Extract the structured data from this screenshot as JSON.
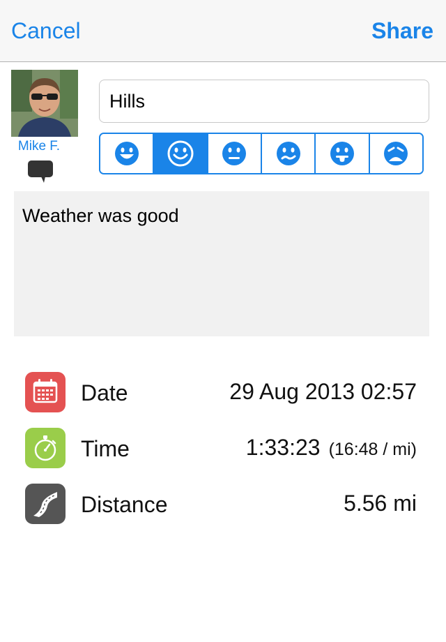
{
  "nav": {
    "cancel_label": "Cancel",
    "share_label": "Share"
  },
  "profile": {
    "name": "Mike F."
  },
  "activity": {
    "title": "Hills"
  },
  "mood": {
    "options": [
      "very-happy",
      "happy",
      "neutral",
      "meh",
      "silly",
      "sad"
    ],
    "selected_index": 1
  },
  "notes": {
    "text": "Weather was good"
  },
  "stats": {
    "date": {
      "label": "Date",
      "value": "29 Aug 2013 02:57"
    },
    "time": {
      "label": "Time",
      "value": "1:33:23",
      "pace": "(16:48 / mi)"
    },
    "distance": {
      "label": "Distance",
      "value": "5.56 mi"
    }
  },
  "colors": {
    "accent": "#1a84e8",
    "date_icon": "#e45252",
    "time_icon": "#9acd4a",
    "distance_icon": "#555555"
  },
  "icons": {
    "date": "calendar-icon",
    "time": "stopwatch-icon",
    "distance": "road-icon",
    "comment": "speech-bubble-icon"
  }
}
